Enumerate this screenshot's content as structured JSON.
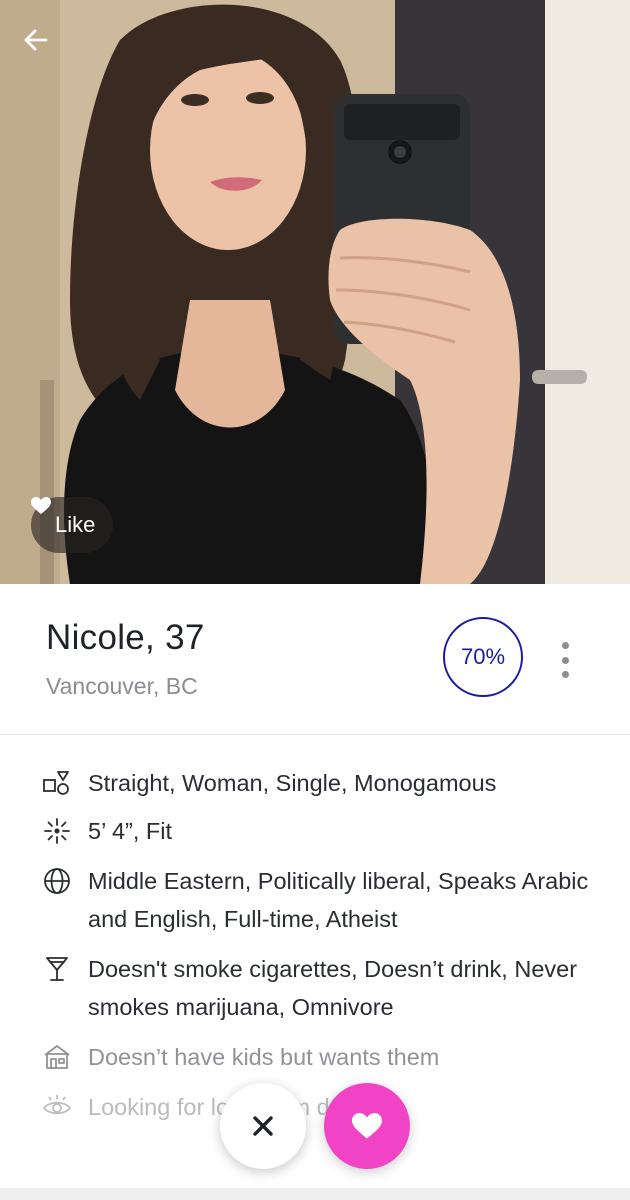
{
  "photo": {
    "back_icon": "arrow-left-icon",
    "like_label": "Like",
    "like_icon": "heart-icon"
  },
  "profile": {
    "name_age": "Nicole, 37",
    "location": "Vancouver, BC",
    "match_percent": "70%",
    "more_icon": "vertical-dots-icon"
  },
  "details": [
    {
      "icon": "gender-shapes-icon",
      "text": "Straight, Woman, Single, Monogamous"
    },
    {
      "icon": "height-sparkle-icon",
      "text": "5’ 4”, Fit"
    },
    {
      "icon": "globe-icon",
      "text": "Middle Eastern, Politically liberal, Speaks Arabic and English, Full-time, Atheist"
    },
    {
      "icon": "cocktail-glass-icon",
      "text": "Doesn't smoke cigarettes, Doesn’t drink, Never smokes marijuana, Omnivore"
    },
    {
      "icon": "house-icon",
      "text": "Doesn’t have kids but wants them"
    },
    {
      "icon": "eye-icon",
      "text": "Looking for           long-term dating."
    }
  ],
  "actions": {
    "pass_icon": "close-icon",
    "like_icon": "heart-icon"
  },
  "colors": {
    "match_ring": "#1a1aa6",
    "like_button": "#f143c5",
    "text_primary": "#1f2228",
    "text_secondary": "#8a8d92"
  }
}
